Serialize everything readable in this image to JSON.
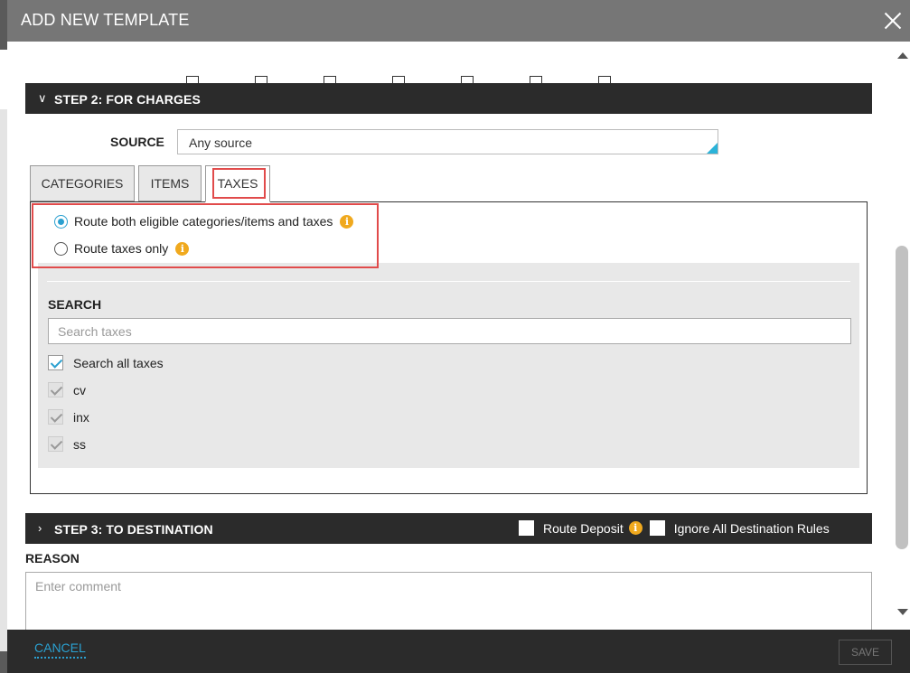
{
  "modal": {
    "title": "ADD NEW TEMPLATE",
    "close_icon": "close-icon"
  },
  "step2": {
    "chevron_icon": "chevron-down-icon",
    "title": "STEP 2:  FOR CHARGES",
    "source": {
      "label": "SOURCE",
      "value": "Any source"
    },
    "tabs": [
      {
        "label": "CATEGORIES",
        "active": false
      },
      {
        "label": "ITEMS",
        "active": false
      },
      {
        "label": "TAXES",
        "active": true
      }
    ],
    "route_options": [
      {
        "label": "Route both eligible categories/items and taxes",
        "selected": true,
        "info_icon": "info-icon"
      },
      {
        "label": "Route taxes only",
        "selected": false,
        "info_icon": "info-icon"
      }
    ],
    "search": {
      "title": "SEARCH",
      "placeholder": "Search taxes",
      "search_all": {
        "label": "Search all taxes",
        "checked": true
      },
      "results": [
        {
          "label": "cv",
          "checked": true
        },
        {
          "label": "inx",
          "checked": true
        },
        {
          "label": "ss",
          "checked": true
        }
      ]
    }
  },
  "step3": {
    "chevron_icon": "chevron-right-icon",
    "title": "STEP 3:  TO DESTINATION",
    "route_deposit": {
      "label": "Route Deposit",
      "checked": false
    },
    "ignore_rules": {
      "label": "Ignore All Destination Rules",
      "checked": false
    }
  },
  "reason": {
    "label": "REASON",
    "placeholder": "Enter comment"
  },
  "footer": {
    "cancel_label": "CANCEL",
    "save_label": "SAVE"
  },
  "colors": {
    "header_bg": "#767676",
    "bar_bg": "#2b2b2b",
    "accent": "#2ba0d0",
    "info": "#f0a91e",
    "highlight": "#e14b4b"
  }
}
